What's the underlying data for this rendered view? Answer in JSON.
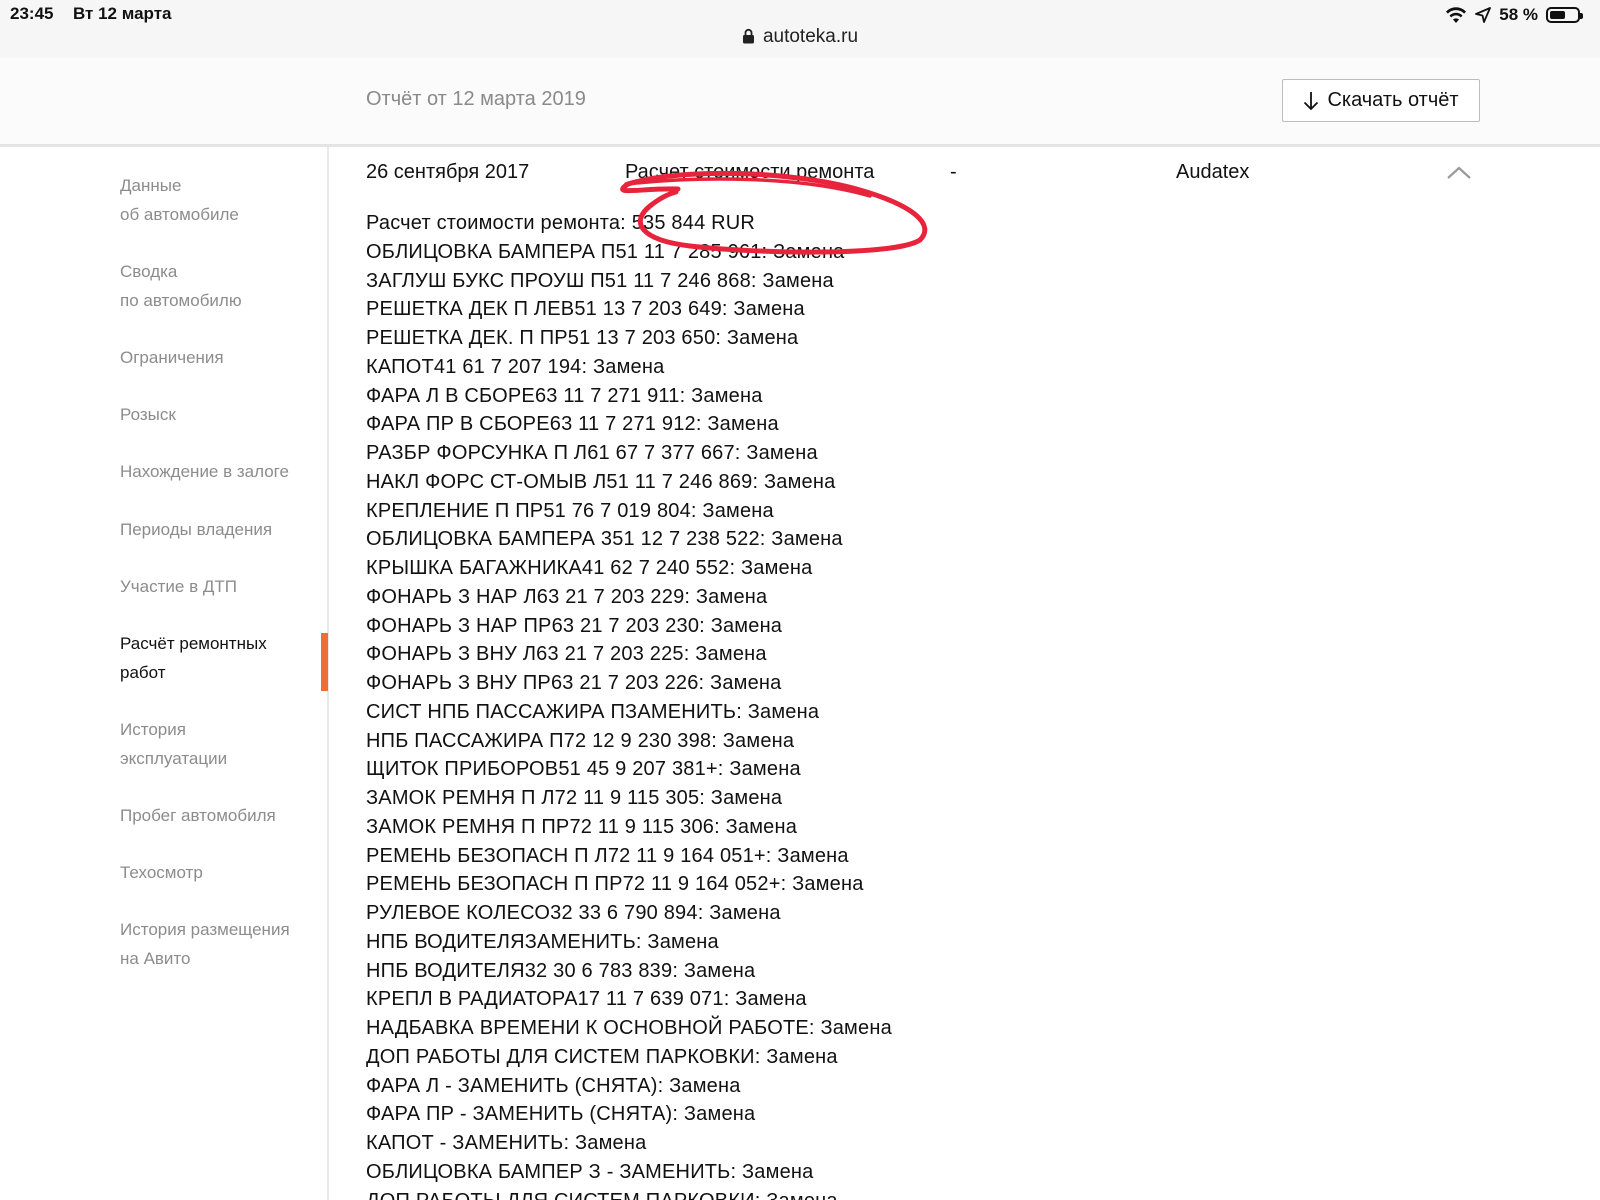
{
  "status_bar": {
    "time": "23:45",
    "date": "Вт 12 марта",
    "battery": "58 %",
    "battery_level": 0.58
  },
  "browser": {
    "url": "autoteka.ru"
  },
  "header": {
    "report_date": "Отчёт от 12 марта 2019",
    "download_label": "Скачать отчёт"
  },
  "sidebar": {
    "items": [
      {
        "line1": "Данные",
        "line2": "об автомобиле"
      },
      {
        "line1": "Сводка",
        "line2": "по автомобилю"
      },
      {
        "line1": "Ограничения",
        "line2": ""
      },
      {
        "line1": "Розыск",
        "line2": ""
      },
      {
        "line1": "Нахождение в залоге",
        "line2": ""
      },
      {
        "line1": "Периоды владения",
        "line2": ""
      },
      {
        "line1": "Участие в ДТП",
        "line2": ""
      },
      {
        "line1": "Расчёт ремонтных",
        "line2": "работ"
      },
      {
        "line1": "История",
        "line2": "эксплуатации"
      },
      {
        "line1": "Пробег автомобиля",
        "line2": ""
      },
      {
        "line1": "Техосмотр",
        "line2": ""
      },
      {
        "line1": "История размещения",
        "line2": "на Авито"
      }
    ]
  },
  "record": {
    "date": "26 сентября 2017",
    "type": "Расчет стоимости ремонта",
    "dash": "-",
    "source": "Audatex",
    "lines": [
      "Расчет стоимости ремонта: 535 844 RUR",
      "ОБЛИЦОВКА БАМПЕРА П51 11 7 285 961: Замена",
      "ЗАГЛУШ БУКС ПРОУШ П51 11 7 246 868: Замена",
      "РЕШЕТКА ДЕК П ЛЕВ51 13 7 203 649: Замена",
      "РЕШЕТКА ДЕК. П ПР51 13 7 203 650: Замена",
      "КАПОТ41 61 7 207 194: Замена",
      "ФАРА Л В СБОРЕ63 11 7 271 911: Замена",
      "ФАРА ПР В СБОРЕ63 11 7 271 912: Замена",
      "РАЗБР ФОРСУНКА П Л61 67 7 377 667: Замена",
      "НАКЛ ФОРС СТ-ОМЫВ Л51 11 7 246 869: Замена",
      "КРЕПЛЕНИЕ П ПР51 76 7 019 804: Замена",
      "ОБЛИЦОВКА БАМПЕРА 351 12 7 238 522: Замена",
      "КРЫШКА БАГАЖНИКА41 62 7 240 552: Замена",
      "ФОНАРЬ З НАР Л63 21 7 203 229: Замена",
      "ФОНАРЬ З НАР ПР63 21 7 203 230: Замена",
      "ФОНАРЬ З ВНУ Л63 21 7 203 225: Замена",
      "ФОНАРЬ З ВНУ ПР63 21 7 203 226: Замена",
      "СИСТ НПБ ПАССАЖИРА ПЗАМЕНИТЬ: Замена",
      "НПБ ПАССАЖИРА П72 12 9 230 398: Замена",
      "ЩИТОК ПРИБОРОВ51 45 9 207 381+: Замена",
      "ЗАМОК РЕМНЯ П Л72 11 9 115 305: Замена",
      "ЗАМОК РЕМНЯ П ПР72 11 9 115 306: Замена",
      "РЕМЕНЬ БЕЗОПАСН П Л72 11 9 164 051+: Замена",
      "РЕМЕНЬ БЕЗОПАСН П ПР72 11 9 164 052+: Замена",
      "РУЛЕВОЕ КОЛЕСО32 33 6 790 894: Замена",
      "НПБ ВОДИТЕЛЯЗАМЕНИТЬ: Замена",
      "НПБ ВОДИТЕЛЯ32 30 6 783 839: Замена",
      "КРЕПЛ В РАДИАТОРА17 11 7 639 071: Замена",
      "НАДБАВКА ВРЕМЕНИ К ОСНОВНОЙ РАБОТЕ: Замена",
      "ДОП РАБОТЫ ДЛЯ СИСТЕМ ПАРКОВКИ: Замена",
      "ФАРА Л - ЗАМЕНИТЬ (СНЯТА): Замена",
      "ФАРА ПР - ЗАМЕНИТЬ (СНЯТА): Замена",
      "КАПОТ - ЗАМЕНИТЬ: Замена",
      "ОБЛИЦОВКА БАМПЕР З - ЗАМЕНИТЬ: Замена",
      "ДОП РАБОТЫ ДЛЯ СИСТЕМ ПАРКОВКИ: Замена"
    ]
  },
  "colors": {
    "accent": "#f26b3a",
    "annotation": "#e8243c",
    "muted_text": "#8c8c8c"
  }
}
